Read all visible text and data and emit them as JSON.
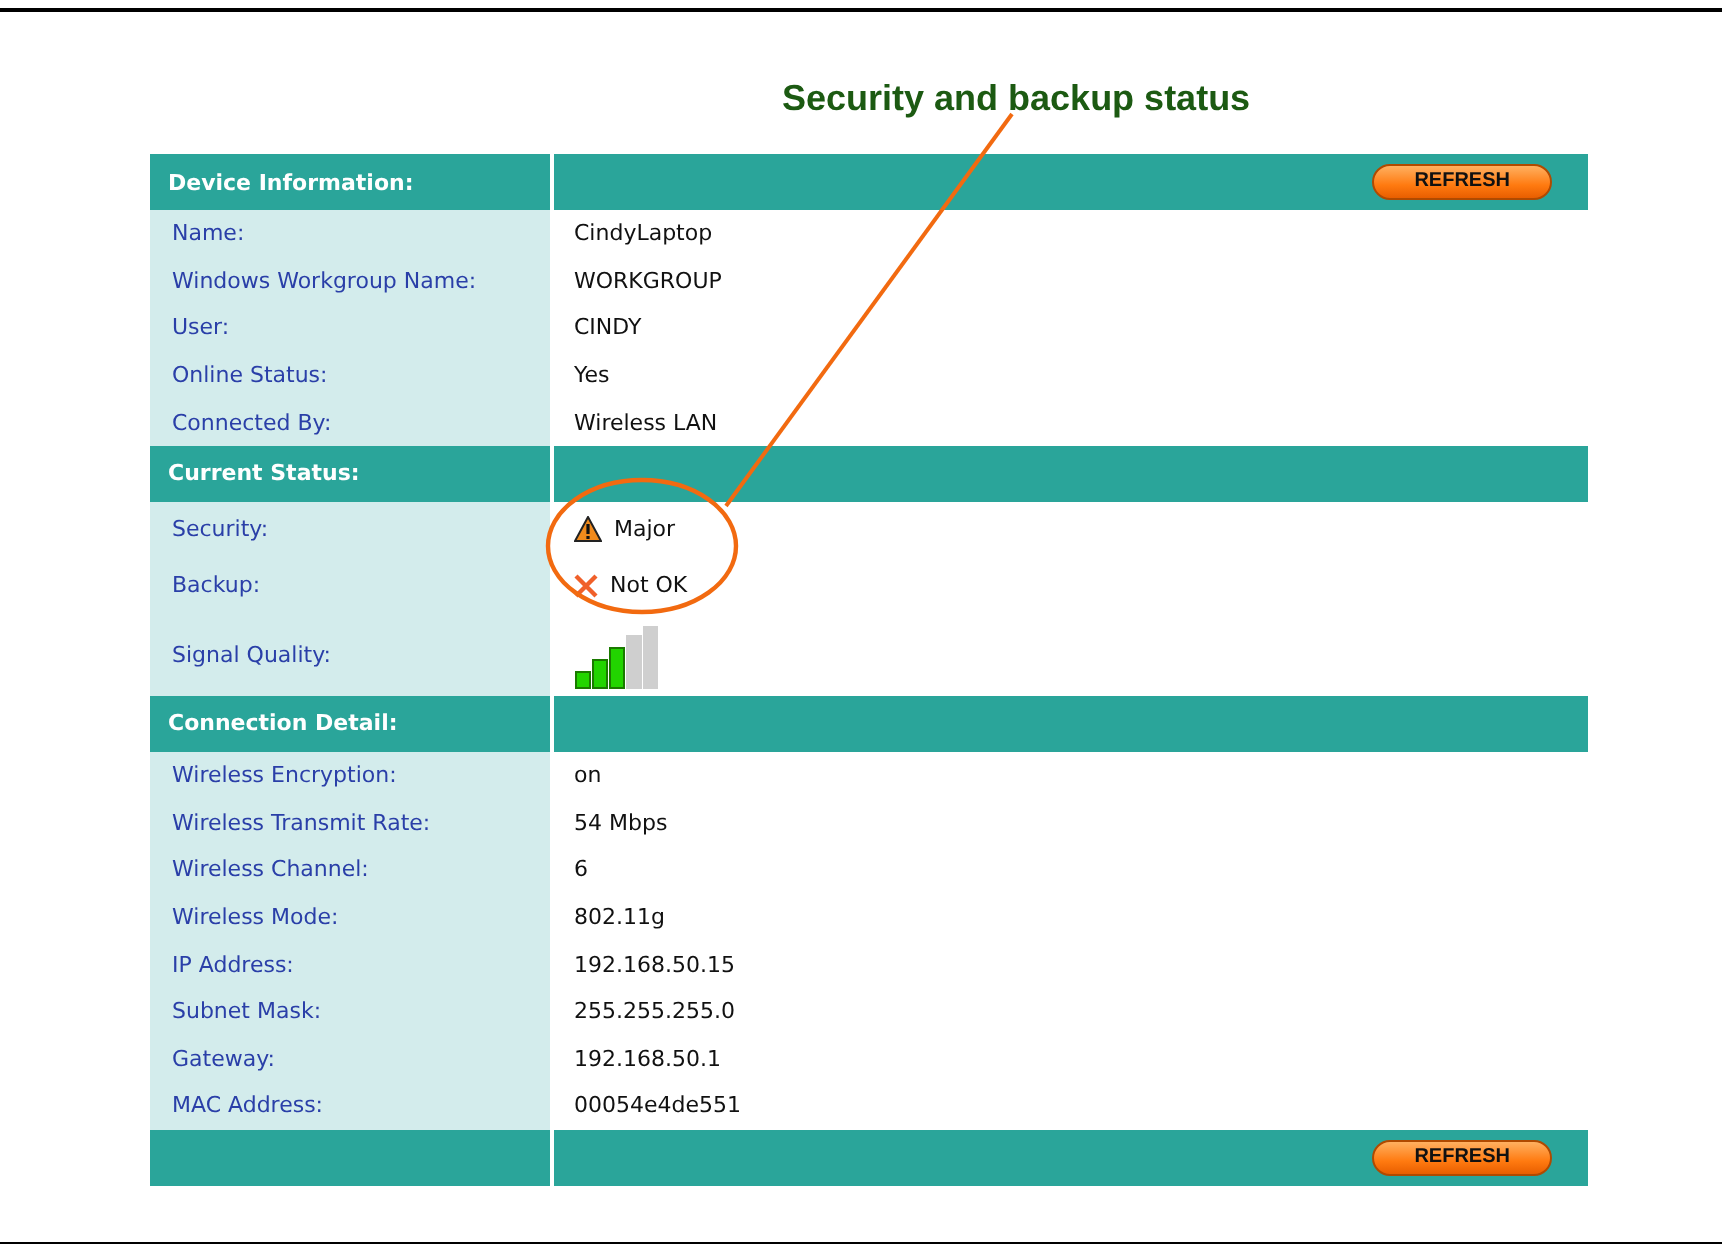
{
  "callout": {
    "title": "Security and backup status"
  },
  "sections": [
    {
      "title": "Device Information:",
      "button": "REFRESH",
      "rows": [
        {
          "kind": "text",
          "label": "Name:",
          "value": "CindyLaptop"
        },
        {
          "kind": "text",
          "label": "Windows Workgroup Name:",
          "value": "WORKGROUP"
        },
        {
          "kind": "text",
          "label": "User:",
          "value": "CINDY"
        },
        {
          "kind": "text",
          "label": "Online Status:",
          "value": "Yes"
        },
        {
          "kind": "text",
          "label": "Connected By:",
          "value": "Wireless LAN"
        }
      ]
    },
    {
      "title": "Current Status:",
      "rows": [
        {
          "kind": "warning",
          "label": "Security:",
          "value": "Major"
        },
        {
          "kind": "error",
          "label": "Backup:",
          "value": "Not OK"
        },
        {
          "kind": "signal",
          "label": "Signal Quality:"
        }
      ]
    },
    {
      "title": "Connection Detail:",
      "rows": [
        {
          "kind": "text",
          "label": "Wireless Encryption:",
          "value": "on"
        },
        {
          "kind": "text",
          "label": "Wireless Transmit Rate:",
          "value": "54 Mbps"
        },
        {
          "kind": "text",
          "label": "Wireless Channel:",
          "value": "6"
        },
        {
          "kind": "text",
          "label": "Wireless Mode:",
          "value": "802.11g"
        },
        {
          "kind": "text",
          "label": "IP Address:",
          "value": "192.168.50.15"
        },
        {
          "kind": "text",
          "label": "Subnet Mask:",
          "value": "255.255.255.0"
        },
        {
          "kind": "text",
          "label": "Gateway:",
          "value": "192.168.50.1"
        },
        {
          "kind": "text",
          "label": "MAC Address:",
          "value": "00054e4de551"
        }
      ]
    }
  ],
  "footer": {
    "button": "REFRESH"
  }
}
